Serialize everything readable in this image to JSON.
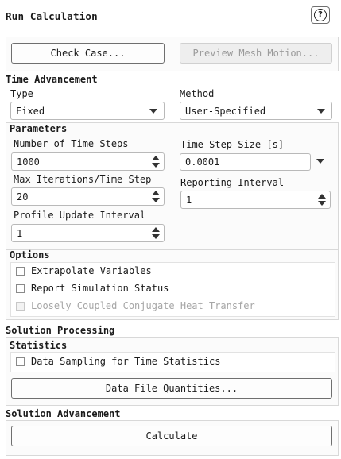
{
  "panel": {
    "title": "Run Calculation",
    "help_glyph": "?",
    "help_icon": "help-icon"
  },
  "top_buttons": {
    "check_case": "Check Case...",
    "preview_mesh_motion": "Preview Mesh Motion..."
  },
  "time_advancement": {
    "title": "Time Advancement",
    "type_label": "Type",
    "type_value": "Fixed",
    "method_label": "Method",
    "method_value": "User-Specified"
  },
  "parameters": {
    "title": "Parameters",
    "num_time_steps_label": "Number of Time Steps",
    "num_time_steps_value": "1000",
    "time_step_size_label": "Time Step Size [s]",
    "time_step_size_value": "0.0001",
    "max_iter_label": "Max Iterations/Time Step",
    "max_iter_value": "20",
    "reporting_interval_label": "Reporting Interval",
    "reporting_interval_value": "1",
    "profile_update_label": "Profile Update Interval",
    "profile_update_value": "1"
  },
  "options": {
    "title": "Options",
    "extrapolate": "Extrapolate Variables",
    "report_status": "Report Simulation Status",
    "loosely_coupled": "Loosely Coupled Conjugate Heat Transfer"
  },
  "solution_processing": {
    "title": "Solution Processing",
    "statistics_title": "Statistics",
    "data_sampling": "Data Sampling for Time Statistics",
    "data_file_quantities": "Data File Quantities..."
  },
  "solution_advancement": {
    "title": "Solution Advancement",
    "calculate": "Calculate"
  }
}
